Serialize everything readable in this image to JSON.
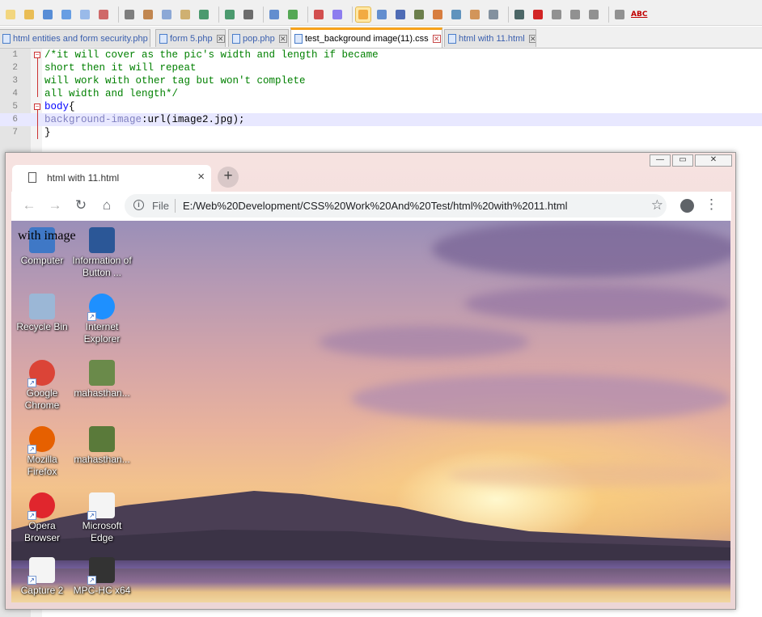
{
  "editor": {
    "tabs": [
      {
        "label": "html entities and form security.php",
        "active": false
      },
      {
        "label": "form 5.php",
        "active": false
      },
      {
        "label": "pop.php",
        "active": false
      },
      {
        "label": "test_background image(11).css",
        "active": true
      },
      {
        "label": "html with 11.html",
        "active": false
      }
    ],
    "toolbar_icons": [
      "new-icon",
      "open-icon",
      "save-icon",
      "save-all-icon",
      "close-icon",
      "close-all-icon",
      "print-icon",
      "cut-icon",
      "copy-icon",
      "paste-icon",
      "undo-icon",
      "redo-icon",
      "find-icon",
      "replace-icon",
      "zoom-in-icon",
      "zoom-out-icon",
      "sync-vertical-icon",
      "sync-horizontal-icon",
      "word-wrap-icon",
      "show-all-characters-icon",
      "indent-guide-icon",
      "user-language-icon",
      "function-list-icon",
      "folder-as-workspace-icon",
      "document-map-icon",
      "monitoring-icon",
      "record-macro-icon",
      "stop-macro-icon",
      "play-macro-icon",
      "run-macro-multiple-icon",
      "save-macro-icon",
      "spell-check-icon"
    ],
    "spell_check_label": "ABC",
    "lines": [
      {
        "num": "1",
        "parts": [
          {
            "t": "/*it will cover as the pic's width and length if became",
            "c": "comment"
          }
        ]
      },
      {
        "num": "2",
        "parts": [
          {
            "t": "short then it will repeat",
            "c": "comment"
          }
        ]
      },
      {
        "num": "3",
        "parts": [
          {
            "t": "will work with other tag but won't complete",
            "c": "comment"
          }
        ]
      },
      {
        "num": "4",
        "parts": [
          {
            "t": "all width and length*/",
            "c": "comment"
          }
        ]
      },
      {
        "num": "5",
        "parts": [
          {
            "t": "body",
            "c": "tag"
          },
          {
            "t": "{",
            "c": "punc"
          }
        ]
      },
      {
        "num": "6",
        "parts": [
          {
            "t": "background-image",
            "c": "prop"
          },
          {
            "t": ":url(image2.jpg);",
            "c": "punc"
          }
        ],
        "highlight": true
      },
      {
        "num": "7",
        "parts": [
          {
            "t": "}",
            "c": "punc"
          }
        ]
      }
    ],
    "colors": {
      "comment": "#008000",
      "tag": "#0000ff",
      "prop": "#8080c0",
      "active_tab_accent": "#f7a21b"
    }
  },
  "browser": {
    "tab_title": "html with 11.html",
    "tab_close": "×",
    "new_tab": "+",
    "back": "←",
    "forward": "→",
    "reload": "↻",
    "home": "⌂",
    "info_glyph": "i",
    "scheme_label": "File",
    "url": "E:/Web%20Development/CSS%20Work%20And%20Test/html%20with%2011.html",
    "star": "☆",
    "menu": "⋮",
    "window_buttons": {
      "minimize": "—",
      "maximize": "▭",
      "close": "✕"
    },
    "page_text": "with image",
    "desktop_icons": [
      {
        "name": "computer-icon",
        "label": "Computer",
        "color": "#3f78c6"
      },
      {
        "name": "word-document-icon",
        "label": "Information of Button ...",
        "color": "#2b5797"
      },
      {
        "name": "recycle-bin-icon",
        "label": "Recycle Bin",
        "color": "#9bb7d6"
      },
      {
        "name": "internet-explorer-icon",
        "label": "Internet Explorer",
        "color": "#1e90ff"
      },
      {
        "name": "google-chrome-icon",
        "label": "Google Chrome",
        "color": "#db4437"
      },
      {
        "name": "image-thumbnail-icon",
        "label": "mahasthan...",
        "color": "#6a8a4a"
      },
      {
        "name": "mozilla-firefox-icon",
        "label": "Mozilla Firefox",
        "color": "#e66000"
      },
      {
        "name": "image-thumbnail-icon",
        "label": "mahasthan...",
        "color": "#5a7a3a"
      },
      {
        "name": "opera-browser-icon",
        "label": "Opera Browser",
        "color": "#e0262d"
      },
      {
        "name": "microsoft-edge-icon",
        "label": "Microsoft Edge",
        "color": "#f4f4f4"
      },
      {
        "name": "capture-icon",
        "label": "Capture 2",
        "color": "#f4f4f4"
      },
      {
        "name": "mpc-hc-icon",
        "label": "MPC-HC x64",
        "color": "#333333"
      }
    ]
  }
}
